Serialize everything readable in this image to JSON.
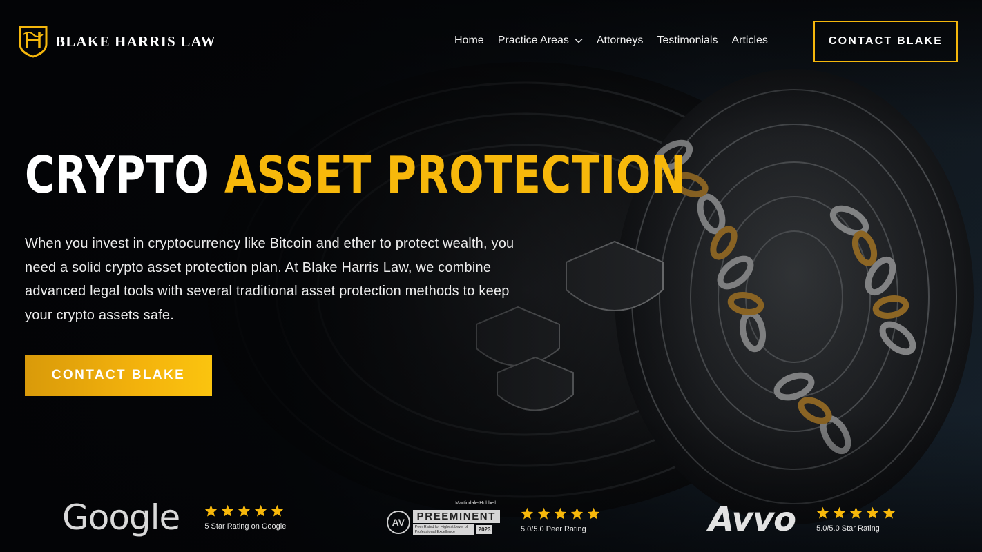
{
  "brand": {
    "name": "BLAKE HARRIS LAW",
    "accent_color": "#f7b80b"
  },
  "nav": {
    "items": [
      {
        "label": "Home"
      },
      {
        "label": "Practice Areas",
        "has_dropdown": true
      },
      {
        "label": "Attorneys"
      },
      {
        "label": "Testimonials"
      },
      {
        "label": "Articles"
      }
    ],
    "cta_label": "CONTACT BLAKE"
  },
  "hero": {
    "title_plain": "CRYPTO",
    "title_accent": "ASSET PROTECTION",
    "description": "When you invest in cryptocurrency like Bitcoin and ether to protect wealth, you need a solid crypto asset protection plan. At Blake Harris Law, we combine advanced legal tools with several traditional asset protection methods to keep your crypto assets safe.",
    "cta_label": "CONTACT BLAKE"
  },
  "ratings": [
    {
      "source": "Google",
      "stars": 5,
      "text": "5 Star Rating on Google"
    },
    {
      "source": "Martindale-Hubbell",
      "badge_top": "Martindale-Hubbell",
      "badge_av": "AV",
      "badge_title": "PREEMINENT",
      "badge_sub": "Peer Rated for Highest Level of Professional Excellence",
      "badge_year": "2023",
      "stars": 5,
      "text": "5.0/5.0 Peer Rating"
    },
    {
      "source": "Avvo",
      "stars": 5,
      "text": "5.0/5.0 Star Rating"
    }
  ]
}
